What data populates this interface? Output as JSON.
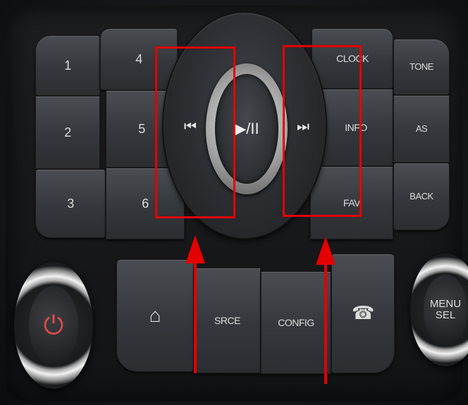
{
  "preset_buttons": {
    "p1": "1",
    "p2": "2",
    "p3": "3",
    "p4": "4",
    "p5": "5",
    "p6": "6"
  },
  "right_buttons": {
    "clock": "CLOCK",
    "info": "INFO",
    "fav": "FAV",
    "tone": "TONE",
    "as": "AS",
    "back": "BACK"
  },
  "bottom_buttons": {
    "srce": "SRCE",
    "config": "CONFIG"
  },
  "dial": {
    "prev_glyph": "⏮",
    "next_glyph": "⏭",
    "play_pause": "▶/II"
  },
  "knob_right": "MENU\nSEL",
  "power_glyph": "⏻",
  "home_glyph": "⌂",
  "phone_glyph": "☎",
  "highlight_color": "#e50000"
}
